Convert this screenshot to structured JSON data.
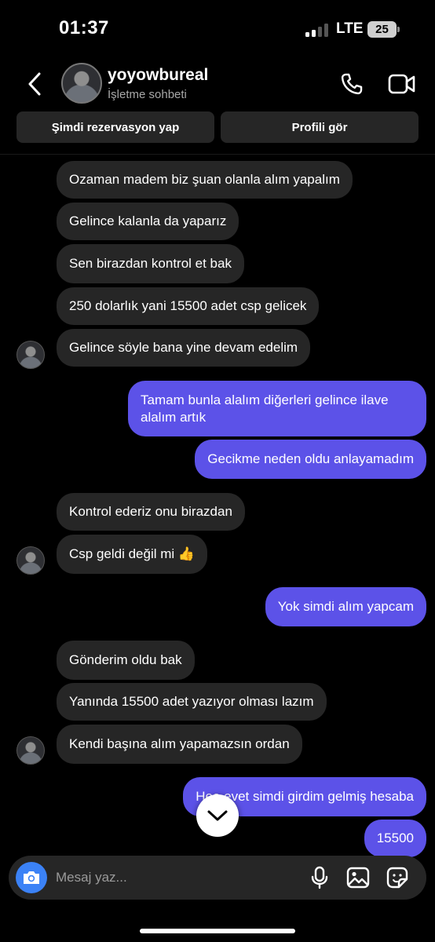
{
  "status_bar": {
    "time": "01:37",
    "network": "LTE",
    "battery": "25"
  },
  "header": {
    "contact_name": "yoyowbureal",
    "subtitle": "İşletme sohbeti"
  },
  "actions": {
    "book": "Şimdi rezervasyon yap",
    "profile": "Profili gör"
  },
  "messages": [
    {
      "from": "them",
      "text": "Ozaman madem biz şuan olanla alım yapalım"
    },
    {
      "from": "them",
      "text": "Gelince kalanla da yaparız"
    },
    {
      "from": "them",
      "text": "Sen birazdan kontrol et bak"
    },
    {
      "from": "them",
      "text": "250 dolarlık yani 15500 adet csp gelicek"
    },
    {
      "from": "them",
      "text": "Gelince söyle bana yine devam edelim"
    },
    {
      "from": "me",
      "text": "Tamam bunla alalım diğerleri gelince ilave alalım artık"
    },
    {
      "from": "me",
      "text": "Gecikme neden oldu anlayamadım"
    },
    {
      "from": "them",
      "text": "Kontrol ederiz onu birazdan"
    },
    {
      "from": "them",
      "text": "Csp geldi değil mi 👍"
    },
    {
      "from": "me",
      "text": "Yok simdi alım yapcam"
    },
    {
      "from": "them",
      "text": "Gönderim oldu bak"
    },
    {
      "from": "them",
      "text": "Yanında 15500 adet yazıyor olması lazım"
    },
    {
      "from": "them",
      "text": "Kendi başına alım yapamazsın ordan"
    },
    {
      "from": "me",
      "text": "Hee evet simdi girdim gelmiş hesaba"
    },
    {
      "from": "me",
      "text": "15500"
    }
  ],
  "composer": {
    "placeholder": "Mesaj yaz..."
  },
  "icons": {
    "back": "chevron-left-icon",
    "call": "phone-icon",
    "video": "video-camera-icon",
    "camera": "camera-icon",
    "mic": "microphone-icon",
    "gallery": "image-icon",
    "sticker": "sticker-icon",
    "scroll_down": "chevron-down-icon"
  },
  "colors": {
    "outgoing_bubble": "#5c52e8",
    "incoming_bubble": "#262626",
    "camera_button": "#3b82f6",
    "background": "#000000"
  }
}
